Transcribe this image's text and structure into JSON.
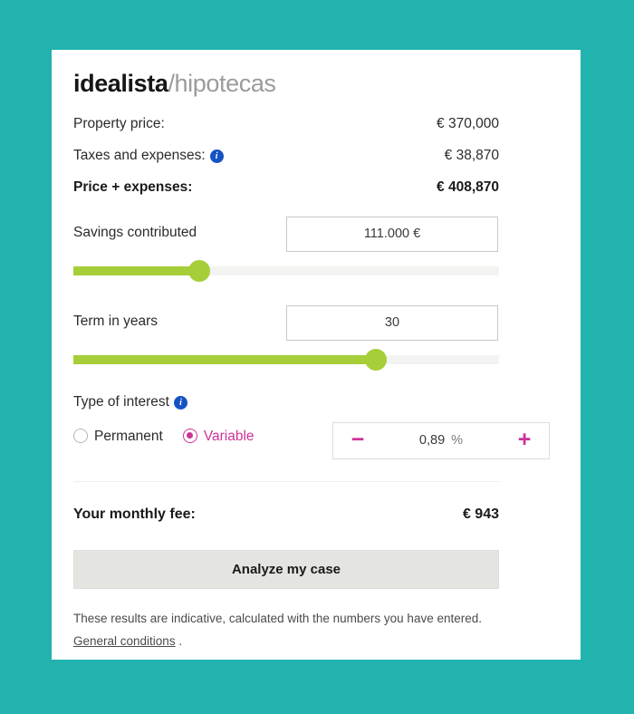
{
  "theme": {
    "page_background": "#22b3ae",
    "card_background": "#ffffff",
    "slider_green": "#a6ce39",
    "accent_pink": "#cc3399",
    "info_blue": "#1552c4",
    "button_gray": "#e4e4e0"
  },
  "brand": {
    "name": "idealista",
    "suffix": "/hipotecas"
  },
  "summary": {
    "property_price_label": "Property price:",
    "property_price_value": "€ 370,000",
    "taxes_label": "Taxes and expenses:",
    "taxes_value": "€ 38,870",
    "taxes_info_icon": "info-icon",
    "total_label": "Price + expenses:",
    "total_value": "€ 408,870"
  },
  "savings": {
    "label": "Savings contributed",
    "value": "111.000 €",
    "placeholder": "111.000 €",
    "slider_percent": 29.5
  },
  "term": {
    "label": "Term in years",
    "value": "30",
    "placeholder": "30",
    "slider_percent": 71
  },
  "interest": {
    "label": "Type of interest",
    "info_icon": "info-icon",
    "options": [
      {
        "label": "Permanent",
        "selected": false
      },
      {
        "label": "Variable",
        "selected": true
      }
    ],
    "permanent_label": "Permanent",
    "variable_label": "Variable",
    "stepper": {
      "minus_icon": "minus-icon",
      "minus_label": "−",
      "value": "0,89",
      "unit": "%",
      "plus_icon": "plus-icon",
      "plus_label": "+"
    }
  },
  "fee": {
    "label": "Your monthly fee:",
    "value": "€ 943"
  },
  "cta": {
    "label": "Analyze my case"
  },
  "footer": {
    "text_before": "These results are indicative, calculated with the numbers you have entered. ",
    "link_label": "General conditions",
    "text_after": " ."
  }
}
